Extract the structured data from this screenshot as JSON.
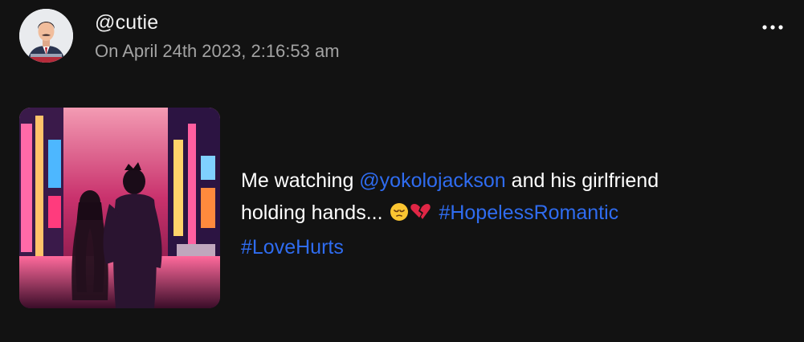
{
  "post": {
    "username": "@cutie",
    "timestamp": "On April 24th 2023, 2:16:53 am",
    "text": {
      "line1_prefix": "Me watching ",
      "mention": "@yokolojackson",
      "line1_suffix": " and his girlfriend",
      "line2_prefix": "holding hands... ",
      "hashtags": [
        "#HopelessRomantic",
        "#LoveHurts"
      ]
    },
    "emojis": [
      "pensive-face-icon",
      "broken-heart-icon"
    ]
  },
  "colors": {
    "background": "#121212",
    "link": "#2f6cf0",
    "timestamp": "#a3a3a3"
  },
  "icons": {
    "more": "more-horizontal-icon"
  }
}
